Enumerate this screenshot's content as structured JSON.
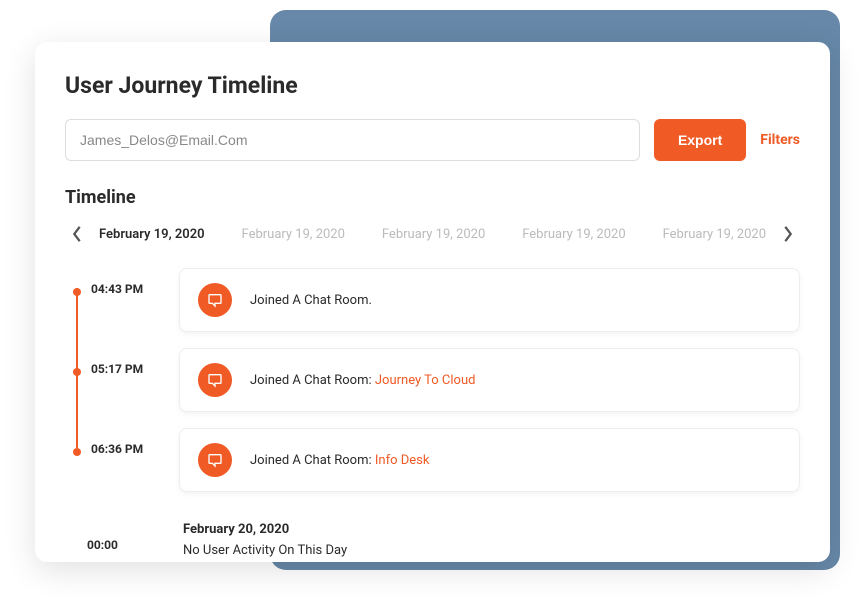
{
  "header": {
    "title": "User Journey Timeline"
  },
  "controls": {
    "search_value": "James_Delos@Email.Com",
    "export_label": "Export",
    "filters_label": "Filters"
  },
  "timeline": {
    "section_title": "Timeline",
    "dates": [
      {
        "label": "February 19, 2020",
        "active": true
      },
      {
        "label": "February 19, 2020",
        "active": false
      },
      {
        "label": "February 19, 2020",
        "active": false
      },
      {
        "label": "February 19, 2020",
        "active": false
      },
      {
        "label": "February 19, 2020",
        "active": false
      }
    ],
    "events": [
      {
        "time": "04:43 PM",
        "text_prefix": "Joined A Chat Room.",
        "link": ""
      },
      {
        "time": "05:17 PM",
        "text_prefix": "Joined A Chat Room: ",
        "link": "Journey To Cloud"
      },
      {
        "time": "06:36 PM",
        "text_prefix": "Joined A Chat Room: ",
        "link": "Info Desk"
      }
    ],
    "empty_day": {
      "time": "00:00",
      "date": "February 20, 2020",
      "message": "No User Activity On This Day"
    }
  },
  "colors": {
    "accent": "#f05a24",
    "backdrop": "#6788a8"
  }
}
